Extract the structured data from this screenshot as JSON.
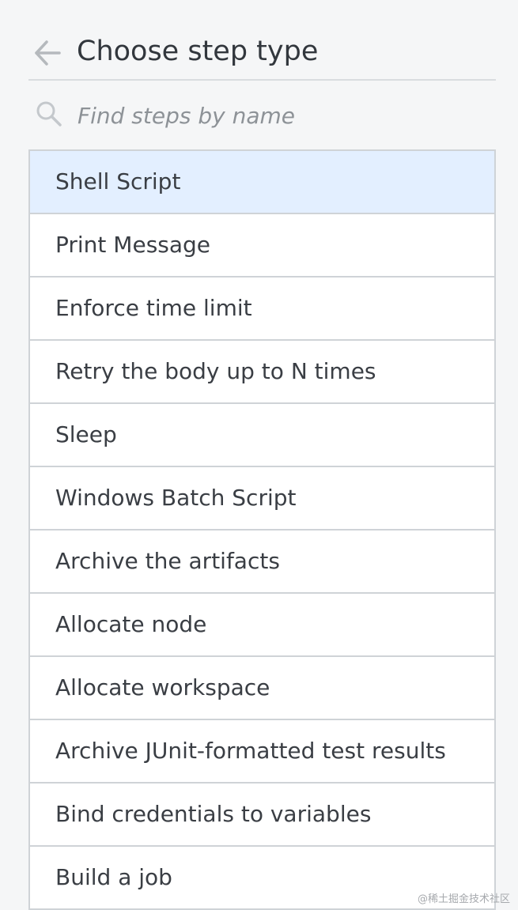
{
  "header": {
    "title": "Choose step type",
    "back_icon": "arrow-left-icon"
  },
  "search": {
    "placeholder": "Find steps by name",
    "value": "",
    "icon": "search-icon"
  },
  "steps": [
    {
      "label": "Shell Script",
      "selected": true
    },
    {
      "label": "Print Message",
      "selected": false
    },
    {
      "label": "Enforce time limit",
      "selected": false
    },
    {
      "label": "Retry the body up to N times",
      "selected": false
    },
    {
      "label": "Sleep",
      "selected": false
    },
    {
      "label": "Windows Batch Script",
      "selected": false
    },
    {
      "label": "Archive the artifacts",
      "selected": false
    },
    {
      "label": "Allocate node",
      "selected": false
    },
    {
      "label": "Allocate workspace",
      "selected": false
    },
    {
      "label": "Archive JUnit-formatted test results",
      "selected": false
    },
    {
      "label": "Bind credentials to variables",
      "selected": false
    },
    {
      "label": "Build a job",
      "selected": false
    }
  ],
  "watermark": "@稀土掘金技术社区",
  "colors": {
    "selected_background": "#e3efff",
    "border": "#cfd3d7",
    "page_background": "#f5f6f7"
  }
}
